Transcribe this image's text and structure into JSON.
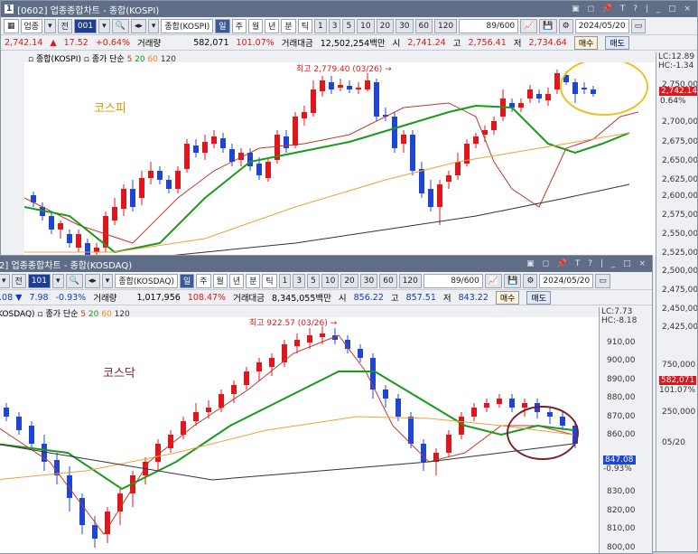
{
  "kospi": {
    "window_title": "[0602] 업종종합차트 - 종합(KOSPI)",
    "window_number": "1",
    "window_controls": "▣ ◻ 📌 T ? | _ □ ×",
    "toolbar": {
      "type_label": "업종",
      "prev_label": "전",
      "code": "001",
      "name": "종합(KOSPI)",
      "periods": [
        "일",
        "주",
        "월",
        "년",
        "분",
        "틱"
      ],
      "minutes": [
        "1",
        "3",
        "5",
        "10",
        "20",
        "30",
        "60",
        "120"
      ],
      "count": "89/600",
      "date": "2024/05/20"
    },
    "info": {
      "price": "2,742.14",
      "change": "17.52",
      "change_pct": "+0.64%",
      "volume_label": "거래량",
      "volume": "582,071",
      "volume_pct": "101.07%",
      "amount_label": "거래대금",
      "amount": "12,502,254백만",
      "open_label": "시",
      "open": "2,741.24",
      "high_label": "고",
      "high": "2,756.41",
      "low_label": "저",
      "low": "2,734.64",
      "buy_label": "매수",
      "sell_label": "매도"
    },
    "legend": {
      "name": "종합(KOSPI)",
      "ma_label": "종가 단순",
      "ma": [
        "5",
        "20",
        "60",
        "120"
      ]
    },
    "annotation": "최고 2,779.40 (03/26) →",
    "big_label": "코스피",
    "axis_ticks": [
      "2,750,00",
      "2,725,00",
      "2,700,00",
      "2,675,00",
      "2,650,00",
      "2,625,00",
      "2,600,00",
      "2,575,00",
      "2,550,00",
      "2,525,00",
      "2,500,00",
      "2,475,00",
      "2,450,00",
      "2,425,00"
    ],
    "axis_lc": "LC:12.89",
    "axis_hc": "HC:-1.34",
    "price_flag": "2,742.14",
    "price_flag_pct": "0.64%",
    "vol_ticks": [
      "750,000",
      "250,000"
    ],
    "vol_flag": "582,071",
    "vol_flag_pct": "101.07%",
    "date_axis": "05/20"
  },
  "kosdaq": {
    "window_title": "2] 업종종합차트 - 종합(KOSDAQ)",
    "window_controls": "▣ ◻ 📌 T ? | _ □ ×",
    "toolbar": {
      "prev_label": "전",
      "code": "101",
      "name": "종합(KOSDAQ)",
      "periods": [
        "일",
        "주",
        "월",
        "년",
        "분",
        "틱"
      ],
      "minutes": [
        "1",
        "3",
        "5",
        "10",
        "20",
        "30",
        "60",
        "120"
      ],
      "count": "89/600",
      "date": "2024/05/20"
    },
    "info": {
      "price": ".08 ▼",
      "change": "7.98",
      "change_pct": "-0.93%",
      "volume_label": "거래량",
      "volume": "1,017,956",
      "volume_pct": "108.47%",
      "amount_label": "거래대금",
      "amount": "8,345,055백만",
      "open_label": "시",
      "open": "856.22",
      "high_label": "고",
      "high": "857.51",
      "low_label": "저",
      "low": "843.22",
      "buy_label": "매수",
      "sell_label": "매도"
    },
    "legend": {
      "name": "KOSDAQ)",
      "ma_label": "종가 단순",
      "ma": [
        "5",
        "20",
        "60",
        "120"
      ]
    },
    "annotation": "최고 922.57 (03/26) →",
    "big_label": "코스닥",
    "axis_ticks": [
      "910,00",
      "900,00",
      "890,00",
      "880,00",
      "870,00",
      "860,00",
      "850,00",
      "840,00",
      "830,00",
      "820,00",
      "810,00",
      "800,00"
    ],
    "axis_lc": "LC:7.73",
    "axis_hc": "HC:-8.18",
    "price_flag": "847.08",
    "price_flag_pct": "-0.93%"
  },
  "colors": {
    "up": "#e0161a",
    "down": "#1f45d6",
    "ma5": "#c0392b",
    "ma20": "#1a9a1a",
    "ma60": "#f0a040",
    "ma120": "#333333",
    "highlight_yellow": "#f0c020",
    "highlight_maroon": "#7a1f2a"
  }
}
